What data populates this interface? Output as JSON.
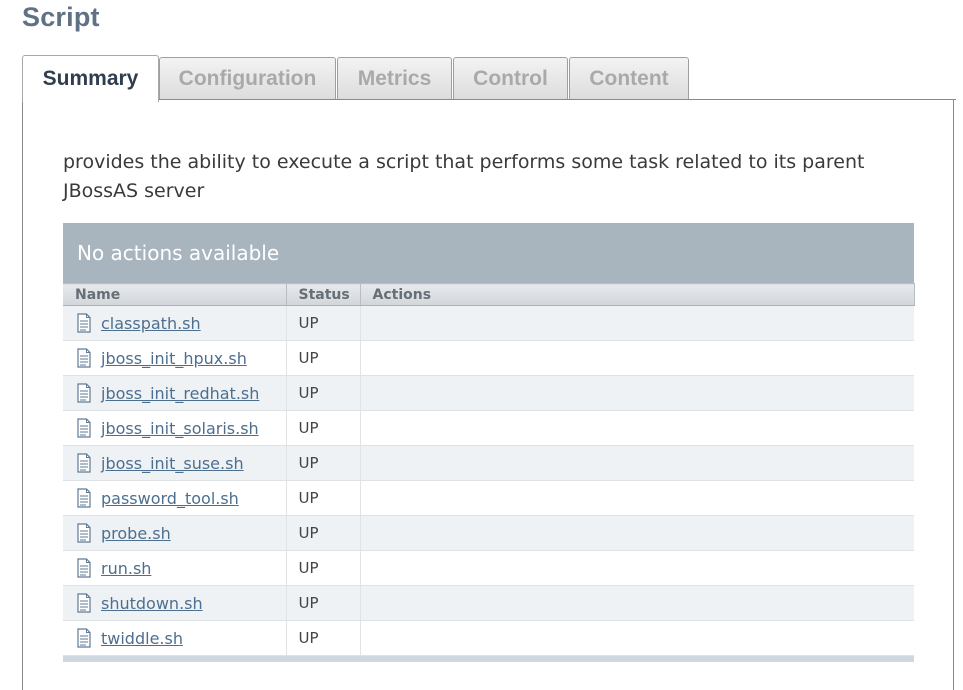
{
  "page": {
    "title": "Script"
  },
  "tabs": [
    {
      "label": "Summary",
      "active": true
    },
    {
      "label": "Configuration",
      "active": false
    },
    {
      "label": "Metrics",
      "active": false
    },
    {
      "label": "Control",
      "active": false
    },
    {
      "label": "Content",
      "active": false
    }
  ],
  "summary": {
    "description": "provides the ability to execute a script that performs some task related to its parent JBossAS server",
    "actions_bar": "No actions available",
    "columns": {
      "name": "Name",
      "status": "Status",
      "actions": "Actions"
    },
    "rows": [
      {
        "name": "classpath.sh",
        "status": "UP",
        "actions": ""
      },
      {
        "name": "jboss_init_hpux.sh",
        "status": "UP",
        "actions": ""
      },
      {
        "name": "jboss_init_redhat.sh",
        "status": "UP",
        "actions": ""
      },
      {
        "name": "jboss_init_solaris.sh",
        "status": "UP",
        "actions": ""
      },
      {
        "name": "jboss_init_suse.sh",
        "status": "UP",
        "actions": ""
      },
      {
        "name": "password_tool.sh",
        "status": "UP",
        "actions": ""
      },
      {
        "name": "probe.sh",
        "status": "UP",
        "actions": ""
      },
      {
        "name": "run.sh",
        "status": "UP",
        "actions": ""
      },
      {
        "name": "shutdown.sh",
        "status": "UP",
        "actions": ""
      },
      {
        "name": "twiddle.sh",
        "status": "UP",
        "actions": ""
      }
    ],
    "row_icon": "document-icon"
  },
  "colors": {
    "title": "#5f7184",
    "link": "#4d6f8f",
    "actions_bar": "#a9b5be",
    "row_alt": "#eef2f5"
  }
}
